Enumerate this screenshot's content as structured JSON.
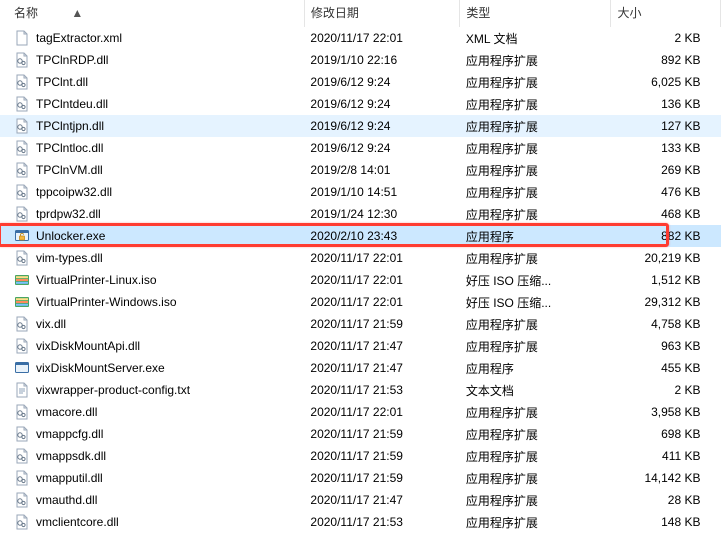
{
  "columns": {
    "name": "名称",
    "date": "修改日期",
    "type": "类型",
    "size": "大小"
  },
  "sort_indicator": "▲",
  "rows": [
    {
      "name": "tagExtractor.xml",
      "date": "2020/11/17 22:01",
      "type": "XML 文档",
      "size": "2 KB",
      "icon": "xml",
      "state": ""
    },
    {
      "name": "TPClnRDP.dll",
      "date": "2019/1/10 22:16",
      "type": "应用程序扩展",
      "size": "892 KB",
      "icon": "dll",
      "state": ""
    },
    {
      "name": "TPClnt.dll",
      "date": "2019/6/12 9:24",
      "type": "应用程序扩展",
      "size": "6,025 KB",
      "icon": "dll",
      "state": ""
    },
    {
      "name": "TPClntdeu.dll",
      "date": "2019/6/12 9:24",
      "type": "应用程序扩展",
      "size": "136 KB",
      "icon": "dll",
      "state": ""
    },
    {
      "name": "TPClntjpn.dll",
      "date": "2019/6/12 9:24",
      "type": "应用程序扩展",
      "size": "127 KB",
      "icon": "dll",
      "state": "hover"
    },
    {
      "name": "TPClntloc.dll",
      "date": "2019/6/12 9:24",
      "type": "应用程序扩展",
      "size": "133 KB",
      "icon": "dll",
      "state": ""
    },
    {
      "name": "TPClnVM.dll",
      "date": "2019/2/8 14:01",
      "type": "应用程序扩展",
      "size": "269 KB",
      "icon": "dll",
      "state": ""
    },
    {
      "name": "tppcoipw32.dll",
      "date": "2019/1/10 14:51",
      "type": "应用程序扩展",
      "size": "476 KB",
      "icon": "dll",
      "state": ""
    },
    {
      "name": "tprdpw32.dll",
      "date": "2019/1/24 12:30",
      "type": "应用程序扩展",
      "size": "468 KB",
      "icon": "dll",
      "state": ""
    },
    {
      "name": "Unlocker.exe",
      "date": "2020/2/10 23:43",
      "type": "应用程序",
      "size": "882 KB",
      "icon": "exe-unlock",
      "state": "selected"
    },
    {
      "name": "vim-types.dll",
      "date": "2020/11/17 22:01",
      "type": "应用程序扩展",
      "size": "20,219 KB",
      "icon": "dll",
      "state": ""
    },
    {
      "name": "VirtualPrinter-Linux.iso",
      "date": "2020/11/17 22:01",
      "type": "好压 ISO 压缩...",
      "size": "1,512 KB",
      "icon": "iso",
      "state": ""
    },
    {
      "name": "VirtualPrinter-Windows.iso",
      "date": "2020/11/17 22:01",
      "type": "好压 ISO 压缩...",
      "size": "29,312 KB",
      "icon": "iso",
      "state": ""
    },
    {
      "name": "vix.dll",
      "date": "2020/11/17 21:59",
      "type": "应用程序扩展",
      "size": "4,758 KB",
      "icon": "dll",
      "state": ""
    },
    {
      "name": "vixDiskMountApi.dll",
      "date": "2020/11/17 21:47",
      "type": "应用程序扩展",
      "size": "963 KB",
      "icon": "dll",
      "state": ""
    },
    {
      "name": "vixDiskMountServer.exe",
      "date": "2020/11/17 21:47",
      "type": "应用程序",
      "size": "455 KB",
      "icon": "exe",
      "state": ""
    },
    {
      "name": "vixwrapper-product-config.txt",
      "date": "2020/11/17 21:53",
      "type": "文本文档",
      "size": "2 KB",
      "icon": "txt",
      "state": ""
    },
    {
      "name": "vmacore.dll",
      "date": "2020/11/17 22:01",
      "type": "应用程序扩展",
      "size": "3,958 KB",
      "icon": "dll",
      "state": ""
    },
    {
      "name": "vmappcfg.dll",
      "date": "2020/11/17 21:59",
      "type": "应用程序扩展",
      "size": "698 KB",
      "icon": "dll",
      "state": ""
    },
    {
      "name": "vmappsdk.dll",
      "date": "2020/11/17 21:59",
      "type": "应用程序扩展",
      "size": "411 KB",
      "icon": "dll",
      "state": ""
    },
    {
      "name": "vmapputil.dll",
      "date": "2020/11/17 21:59",
      "type": "应用程序扩展",
      "size": "14,142 KB",
      "icon": "dll",
      "state": ""
    },
    {
      "name": "vmauthd.dll",
      "date": "2020/11/17 21:47",
      "type": "应用程序扩展",
      "size": "28 KB",
      "icon": "dll",
      "state": ""
    },
    {
      "name": "vmclientcore.dll",
      "date": "2020/11/17 21:53",
      "type": "应用程序扩展",
      "size": "148 KB",
      "icon": "dll",
      "state": ""
    }
  ],
  "highlight_row_index": 9
}
